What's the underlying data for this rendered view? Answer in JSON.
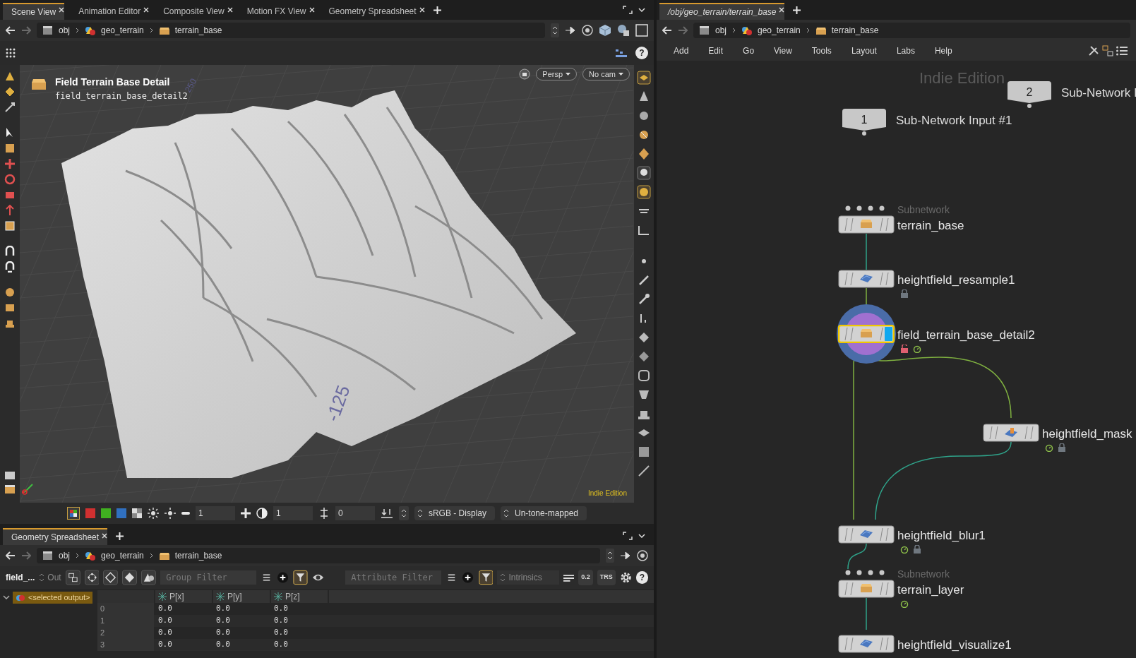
{
  "left_pane": {
    "tabs": [
      {
        "label": "Scene View",
        "selected": true
      },
      {
        "label": "Animation Editor",
        "selected": false
      },
      {
        "label": "Composite View",
        "selected": false
      },
      {
        "label": "Motion FX View",
        "selected": false
      },
      {
        "label": "Geometry Spreadsheet",
        "selected": false
      }
    ],
    "path": [
      "obj",
      "geo_terrain",
      "terrain_base"
    ],
    "help": "?"
  },
  "viewport": {
    "title": "Field Terrain Base Detail",
    "subtitle": "field_terrain_base_detail2",
    "camera_menus": [
      "Persp",
      "No cam"
    ],
    "grid_labels": [
      "250",
      "-125"
    ],
    "watermark": "Indie Edition"
  },
  "display_bar": {
    "fields": [
      "1",
      "1",
      "0"
    ],
    "colorspace": "sRGB - Display",
    "tonemap": "Un-tone-mapped"
  },
  "spreadsheet": {
    "tabs": [
      {
        "label": "Geometry Spreadsheet",
        "selected": true
      }
    ],
    "path": [
      "obj",
      "geo_terrain",
      "terrain_base"
    ],
    "node_label": "field_...",
    "out_label": "Out",
    "group_filter": {
      "placeholder": "Group Filter"
    },
    "attribute_filter": {
      "placeholder": "Attribute Filter"
    },
    "intrinsics": "Intrinsics",
    "precision_label": "0.2",
    "trs_label": "TRS",
    "help": "?",
    "tree_item": {
      "label": "<selected output>",
      "selected": true
    },
    "columns": [
      "P[x]",
      "P[y]",
      "P[z]"
    ],
    "rows": [
      [
        "0",
        "0.0",
        "0.0",
        "0.0"
      ],
      [
        "1",
        "0.0",
        "0.0",
        "0.0"
      ],
      [
        "2",
        "0.0",
        "0.0",
        "0.0"
      ],
      [
        "3",
        "0.0",
        "0.0",
        "0.0"
      ]
    ]
  },
  "network": {
    "tabs": [
      {
        "label": "/obj/geo_terrain/terrain_base",
        "selected": true
      }
    ],
    "path": [
      "obj",
      "geo_terrain",
      "terrain_base"
    ],
    "menu": [
      "Add",
      "Edit",
      "Go",
      "View",
      "Tools",
      "Layout",
      "Labs",
      "Help"
    ],
    "watermark": "Indie Edition",
    "inputs": [
      {
        "number": "1",
        "label": "Sub-Network Input #1"
      },
      {
        "number": "2",
        "label": "Sub-Network I"
      }
    ],
    "nodes": [
      {
        "kind": "subnetwork",
        "type_label": "Subnetwork",
        "name": "terrain_base",
        "selected": false,
        "display": false,
        "locked": false,
        "unlocked": false,
        "timer": false
      },
      {
        "kind": "heightfield",
        "name": "heightfield_resample1",
        "selected": false,
        "display": false,
        "locked": true,
        "unlocked": false,
        "timer": false
      },
      {
        "kind": "subnetwork_plain",
        "name": "field_terrain_base_detail2",
        "selected": true,
        "display": true,
        "locked": false,
        "unlocked": true,
        "timer": true
      },
      {
        "kind": "mask",
        "name": "heightfield_mask",
        "selected": false,
        "display": false,
        "locked": true,
        "unlocked": false,
        "timer": true
      },
      {
        "kind": "heightfield",
        "name": "heightfield_blur1",
        "selected": false,
        "display": false,
        "locked": true,
        "unlocked": false,
        "timer": true
      },
      {
        "kind": "subnetwork",
        "type_label": "Subnetwork",
        "name": "terrain_layer",
        "selected": false,
        "display": false,
        "locked": false,
        "unlocked": false,
        "timer": true
      },
      {
        "kind": "heightfield",
        "name": "heightfield_visualize1",
        "selected": false,
        "display": false,
        "locked": false,
        "unlocked": false,
        "timer": false
      }
    ]
  }
}
